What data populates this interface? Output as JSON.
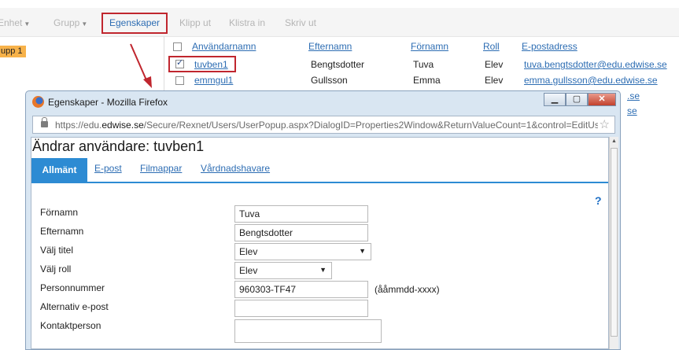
{
  "toolbar": {
    "enhet": "Enhet",
    "grupp": "Grupp",
    "egenskaper": "Egenskaper",
    "klipp_ut": "Klipp ut",
    "klistra_in": "Klistra in",
    "skriv_ut": "Skriv ut"
  },
  "side_tag": "upp 1",
  "grid": {
    "headers": [
      "Användarnamn",
      "Efternamn",
      "Förnamn",
      "Roll",
      "E-postadress"
    ],
    "rows": [
      {
        "username": "tuvben1",
        "lastname": "Bengtsdotter",
        "firstname": "Tuva",
        "role": "Elev",
        "email": "tuva.bengtsdotter@edu.edwise.se",
        "checked": true
      },
      {
        "username": "emmgul1",
        "lastname": "Gullsson",
        "firstname": "Emma",
        "role": "Elev",
        "email": "emma.gullsson@edu.edwise.se",
        "checked": false
      }
    ],
    "hidden_email_tails": [
      ".se",
      "se"
    ]
  },
  "popup": {
    "title": "Egenskaper - Mozilla Firefox",
    "url_prefix": "https://edu.",
    "url_domain": "edwise.se",
    "url_rest": "/Secure/Rexnet/Users/UserPopup.aspx?DialogID=Properties2Window&ReturnValueCount=1&control=EditUse",
    "heading": "Ändrar användare:  tuvben1",
    "tabs": [
      "Allmänt",
      "E-post",
      "Filmappar",
      "Vårdnadshavare"
    ],
    "help": "?",
    "form": {
      "fornamn_label": "Förnamn",
      "fornamn_value": "Tuva",
      "efternamn_label": "Efternamn",
      "efternamn_value": "Bengtsdotter",
      "titel_label": "Välj titel",
      "titel_value": "Elev",
      "roll_label": "Välj roll",
      "roll_value": "Elev",
      "personnummer_label": "Personnummer",
      "personnummer_value": "960303-TF47",
      "personnummer_hint": "(ååmmdd-xxxx)",
      "alt_epost_label": "Alternativ e-post",
      "alt_epost_value": "",
      "kontakt_label": "Kontaktperson",
      "kontakt_value": ""
    }
  },
  "colors": {
    "link": "#2d6db3",
    "accent": "#2d8bd3",
    "highlight": "#c0262e",
    "tag": "#f7b24a"
  }
}
